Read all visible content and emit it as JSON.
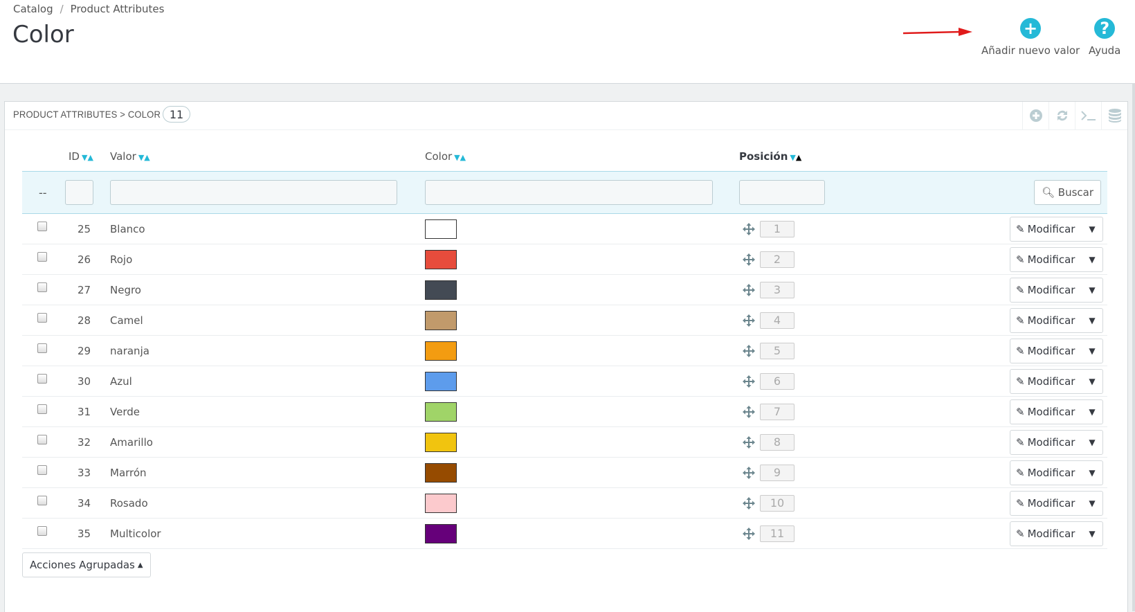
{
  "breadcrumb": {
    "parent": "Catalog",
    "separator": "/",
    "current": "Product Attributes"
  },
  "page": {
    "title": "Color"
  },
  "toolbar": {
    "add_label": "Añadir nuevo valor",
    "help_label": "Ayuda",
    "add_icon": "plus-circle-icon",
    "help_icon": "question-circle-icon"
  },
  "panel": {
    "title": "PRODUCT ATTRIBUTES > COLOR",
    "count": "11"
  },
  "columns": {
    "id": "ID",
    "value": "Valor",
    "color": "Color",
    "position": "Posición"
  },
  "filters": {
    "bulk_placeholder": "--",
    "search_label": "Buscar"
  },
  "row_action": {
    "edit_label": "Modificar"
  },
  "rows": [
    {
      "id": "25",
      "value": "Blanco",
      "color": "#ffffff",
      "position": "1"
    },
    {
      "id": "26",
      "value": "Rojo",
      "color": "#e74c3c",
      "position": "2"
    },
    {
      "id": "27",
      "value": "Negro",
      "color": "#434a54",
      "position": "3"
    },
    {
      "id": "28",
      "value": "Camel",
      "color": "#c19a6b",
      "position": "4"
    },
    {
      "id": "29",
      "value": "naranja",
      "color": "#f39c11",
      "position": "5"
    },
    {
      "id": "30",
      "value": "Azul",
      "color": "#5d9cec",
      "position": "6"
    },
    {
      "id": "31",
      "value": "Verde",
      "color": "#a0d468",
      "position": "7"
    },
    {
      "id": "32",
      "value": "Amarillo",
      "color": "#f1c40f",
      "position": "8"
    },
    {
      "id": "33",
      "value": "Marrón",
      "color": "#964b00",
      "position": "9"
    },
    {
      "id": "34",
      "value": "Rosado",
      "color": "#fccacd",
      "position": "10"
    },
    {
      "id": "35",
      "value": "Multicolor",
      "color": "#66007a",
      "position": "11"
    }
  ],
  "footer": {
    "bulk_actions_label": "Acciones Agrupadas"
  },
  "accent_color": "#25b9d7"
}
